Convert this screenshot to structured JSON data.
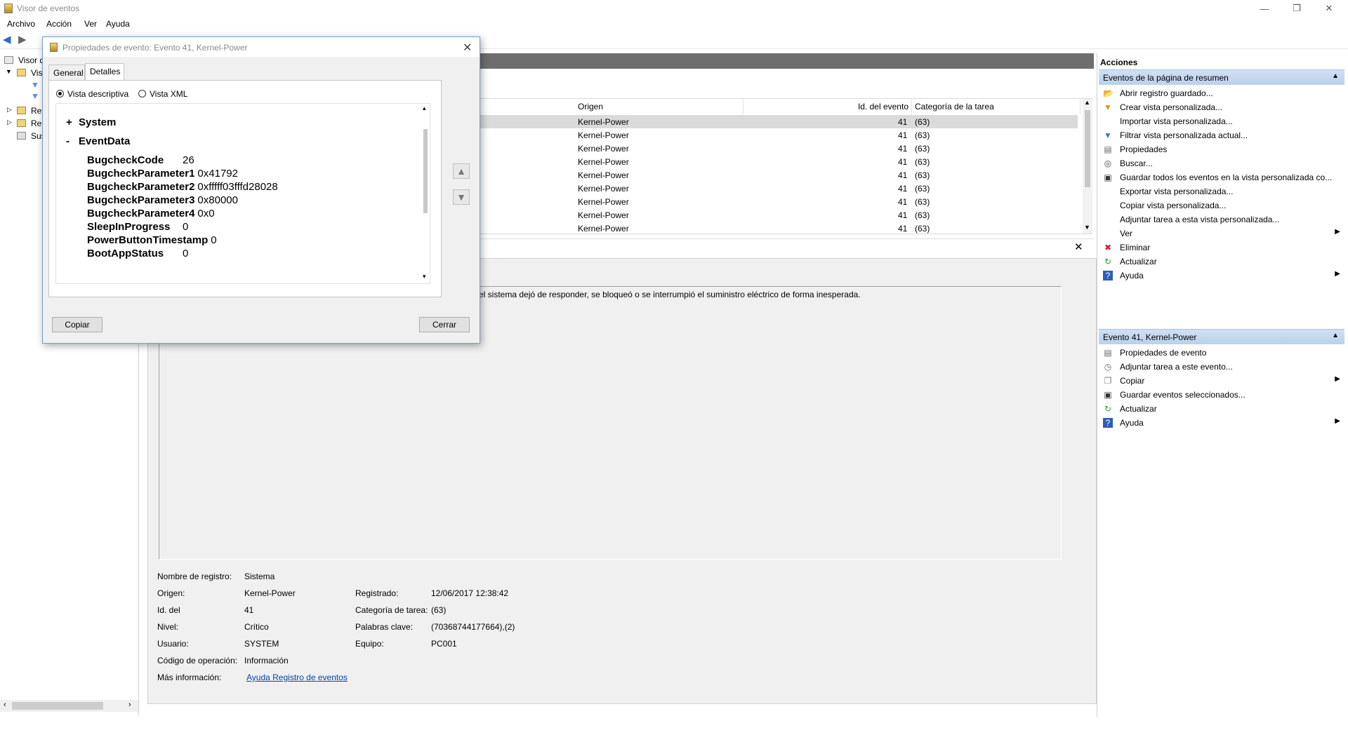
{
  "window": {
    "title": "Visor de eventos",
    "minimize_glyph": "—",
    "restore_glyph": "❐",
    "close_glyph": "✕"
  },
  "menu": [
    "Archivo",
    "Acción",
    "Ver",
    "Ayuda"
  ],
  "tree": {
    "items": [
      {
        "label": "Visor d"
      },
      {
        "label": "Vis"
      },
      {
        "label": "Re"
      },
      {
        "label": "Re"
      },
      {
        "label": "Sus"
      }
    ]
  },
  "grid": {
    "columns": [
      "Origen",
      "Id. del evento",
      "Categoría de la tarea"
    ],
    "rows": [
      {
        "origen": "Kernel-Power",
        "id": "41",
        "cat": "(63)"
      },
      {
        "origen": "Kernel-Power",
        "id": "41",
        "cat": "(63)"
      },
      {
        "origen": "Kernel-Power",
        "id": "41",
        "cat": "(63)"
      },
      {
        "origen": "Kernel-Power",
        "id": "41",
        "cat": "(63)"
      },
      {
        "origen": "Kernel-Power",
        "id": "41",
        "cat": "(63)"
      },
      {
        "origen": "Kernel-Power",
        "id": "41",
        "cat": "(63)"
      },
      {
        "origen": "Kernel-Power",
        "id": "41",
        "cat": "(63)"
      },
      {
        "origen": "Kernel-Power",
        "id": "41",
        "cat": "(63)"
      },
      {
        "origen": "Kernel-Power",
        "id": "41",
        "cat": "(63)"
      }
    ]
  },
  "preview": {
    "description": "el sistema dejó de responder, se bloqueó o se interrumpió el suministro eléctrico de forma inesperada.",
    "props": {
      "log_name_label": "Nombre de registro:",
      "log_name": "Sistema",
      "source_label": "Origen:",
      "source": "Kernel-Power",
      "registered_label": "Registrado:",
      "registered": "12/06/2017 12:38:42",
      "id_label": "Id. del",
      "id": "41",
      "task_cat_label": "Categoría de tarea:",
      "task_cat": "(63)",
      "level_label": "Nivel:",
      "level": "Crítico",
      "keywords_label": "Palabras clave:",
      "keywords": "(70368744177664),(2)",
      "user_label": "Usuario:",
      "user": "SYSTEM",
      "computer_label": "Equipo:",
      "computer": "PC001",
      "opcode_label": "Código de operación:",
      "opcode": "Información",
      "more_info_label": "Más información:",
      "more_info_link": "Ayuda Registro de eventos"
    }
  },
  "actions": {
    "title": "Acciones",
    "section1": "Eventos de la página de resumen",
    "section1_items": [
      {
        "label": "Abrir registro guardado...",
        "icon": "folder-open-icon"
      },
      {
        "label": "Crear vista personalizada...",
        "icon": "filter-create-icon"
      },
      {
        "label": "Importar vista personalizada...",
        "icon": ""
      },
      {
        "label": "Filtrar vista personalizada actual...",
        "icon": "filter-icon"
      },
      {
        "label": "Propiedades",
        "icon": "properties-icon"
      },
      {
        "label": "Buscar...",
        "icon": "binoculars-icon"
      },
      {
        "label": "Guardar todos los eventos en la vista personalizada co...",
        "icon": "save-icon"
      },
      {
        "label": "Exportar vista personalizada...",
        "icon": ""
      },
      {
        "label": "Copiar vista personalizada...",
        "icon": ""
      },
      {
        "label": "Adjuntar tarea a esta vista personalizada...",
        "icon": ""
      },
      {
        "label": "Ver",
        "icon": "",
        "submenu": true
      },
      {
        "label": "Eliminar",
        "icon": "delete-icon"
      },
      {
        "label": "Actualizar",
        "icon": "refresh-icon"
      },
      {
        "label": "Ayuda",
        "icon": "help-icon",
        "submenu": true
      }
    ],
    "section2": "Evento 41, Kernel-Power",
    "section2_items": [
      {
        "label": "Propiedades de evento",
        "icon": "event-properties-icon"
      },
      {
        "label": "Adjuntar tarea a este evento...",
        "icon": "attach-task-icon"
      },
      {
        "label": "Copiar",
        "icon": "copy-icon",
        "submenu": true
      },
      {
        "label": "Guardar eventos seleccionados...",
        "icon": "save-icon"
      },
      {
        "label": "Actualizar",
        "icon": "refresh-icon"
      },
      {
        "label": "Ayuda",
        "icon": "help-icon",
        "submenu": true
      }
    ]
  },
  "dialog": {
    "title": "Propiedades de evento: Evento 41, Kernel-Power",
    "tabs": [
      "General",
      "Detalles"
    ],
    "radio_descriptive": "Vista descriptiva",
    "radio_xml": "Vista XML",
    "xml": {
      "system_toggle": "+",
      "system": "System",
      "eventdata_toggle": "-",
      "eventdata": "EventData",
      "fields": [
        {
          "key": "BugcheckCode",
          "value": "26"
        },
        {
          "key": "BugcheckParameter1",
          "value": "0x41792"
        },
        {
          "key": "BugcheckParameter2",
          "value": "0xfffff03fffd28028"
        },
        {
          "key": "BugcheckParameter3",
          "value": "0x80000"
        },
        {
          "key": "BugcheckParameter4",
          "value": "0x0"
        },
        {
          "key": "SleepInProgress",
          "value": "0"
        },
        {
          "key": "PowerButtonTimestamp",
          "value": "0"
        },
        {
          "key": "BootAppStatus",
          "value": "0"
        }
      ]
    },
    "copy_button": "Copiar",
    "close_button": "Cerrar"
  }
}
